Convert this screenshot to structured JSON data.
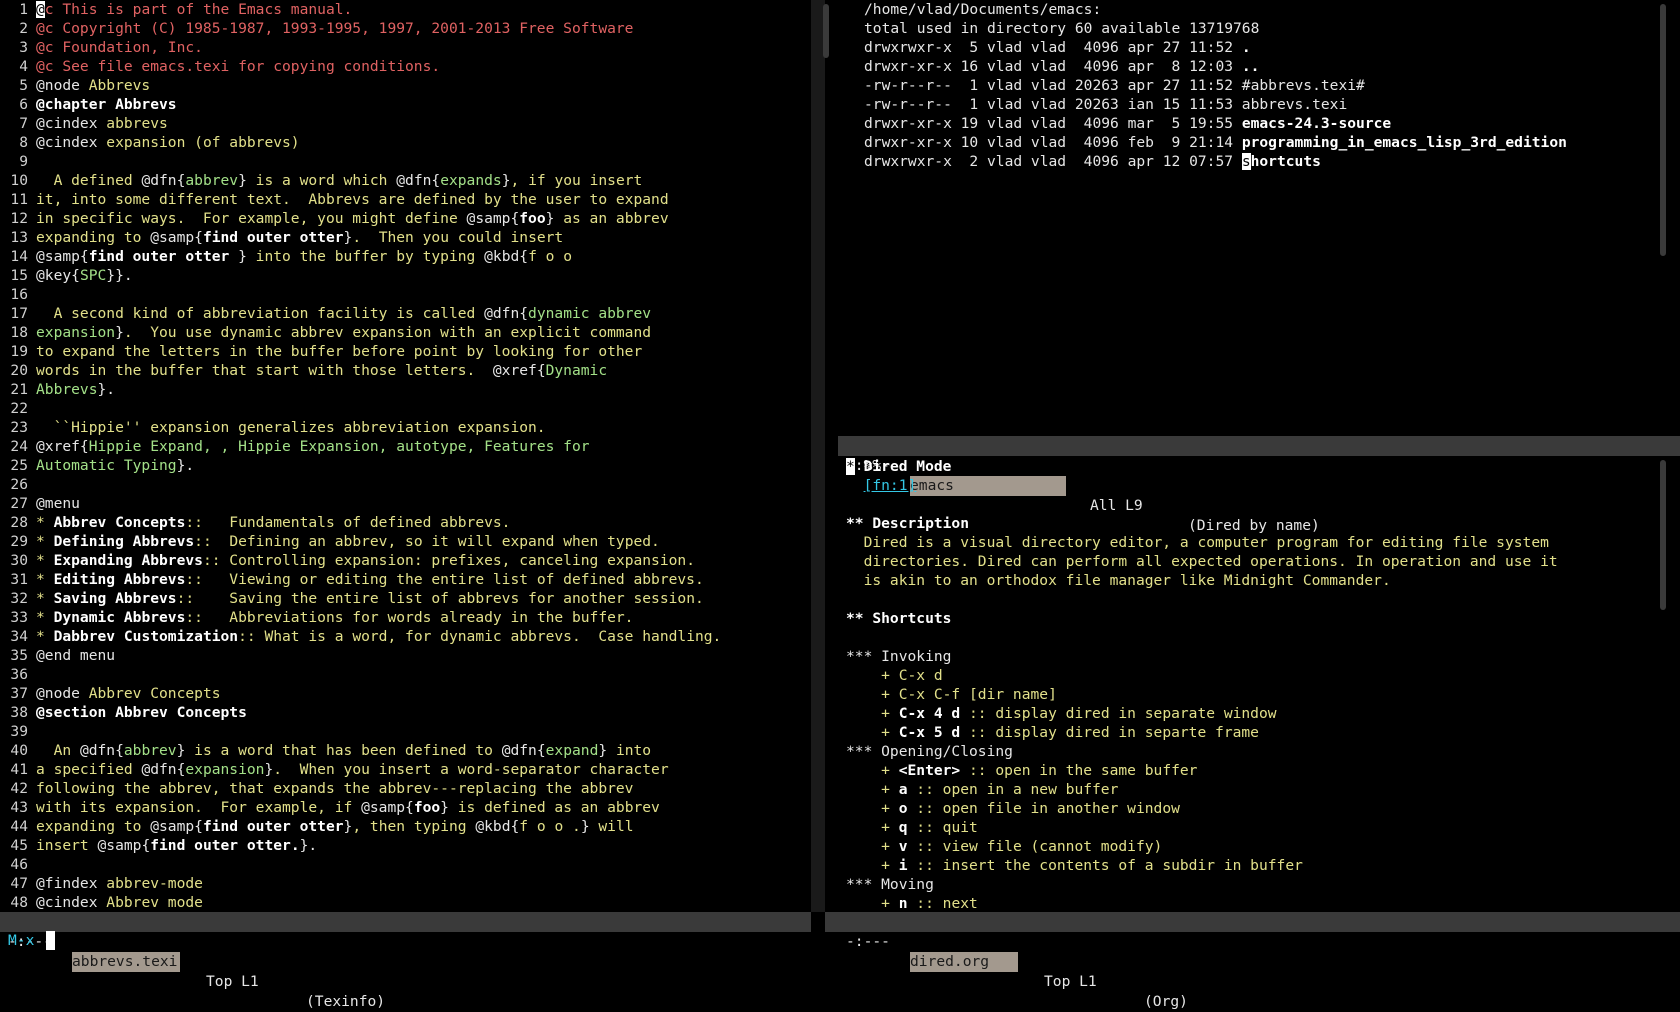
{
  "left_window": {
    "lines": [
      {
        "n": "1",
        "segs": [
          {
            "t": "@",
            "c": "cursor"
          },
          {
            "t": "c This is part of the Emacs manual.",
            "c": "r"
          }
        ]
      },
      {
        "n": "2",
        "segs": [
          {
            "t": "@c Copyright (C) 1985-1987, 1993-1995, 1997, 2001-2013 Free Software",
            "c": "r"
          }
        ]
      },
      {
        "n": "3",
        "segs": [
          {
            "t": "@c Foundation, Inc.",
            "c": "r"
          }
        ]
      },
      {
        "n": "4",
        "segs": [
          {
            "t": "@c See file emacs.texi for copying conditions.",
            "c": "r"
          }
        ]
      },
      {
        "n": "5",
        "segs": [
          {
            "t": "@node ",
            "c": "w"
          },
          {
            "t": "Abbrevs",
            "c": "y"
          }
        ]
      },
      {
        "n": "6",
        "segs": [
          {
            "t": "@chapter Abbrevs",
            "c": "b"
          }
        ]
      },
      {
        "n": "7",
        "segs": [
          {
            "t": "@cindex ",
            "c": "w"
          },
          {
            "t": "abbrevs",
            "c": "y"
          }
        ]
      },
      {
        "n": "8",
        "segs": [
          {
            "t": "@cindex ",
            "c": "w"
          },
          {
            "t": "expansion (of abbrevs)",
            "c": "y"
          }
        ]
      },
      {
        "n": "9",
        "segs": []
      },
      {
        "n": "10",
        "segs": [
          {
            "t": "  A defined ",
            "c": "y"
          },
          {
            "t": "@dfn{",
            "c": "w"
          },
          {
            "t": "abbrev",
            "c": "g"
          },
          {
            "t": "}",
            "c": "w"
          },
          {
            "t": " is a word which ",
            "c": "y"
          },
          {
            "t": "@dfn{",
            "c": "w"
          },
          {
            "t": "expands",
            "c": "g"
          },
          {
            "t": "}",
            "c": "w"
          },
          {
            "t": ", if you insert",
            "c": "y"
          }
        ]
      },
      {
        "n": "11",
        "segs": [
          {
            "t": "it, into some different text.  Abbrevs are defined by the user to expand",
            "c": "y"
          }
        ]
      },
      {
        "n": "12",
        "segs": [
          {
            "t": "in specific ways.  For example, you might define ",
            "c": "y"
          },
          {
            "t": "@samp{",
            "c": "w"
          },
          {
            "t": "foo",
            "c": "b"
          },
          {
            "t": "}",
            "c": "w"
          },
          {
            "t": " as an abbrev",
            "c": "y"
          }
        ]
      },
      {
        "n": "13",
        "segs": [
          {
            "t": "expanding to ",
            "c": "y"
          },
          {
            "t": "@samp{",
            "c": "w"
          },
          {
            "t": "find outer otter",
            "c": "b"
          },
          {
            "t": "}",
            "c": "w"
          },
          {
            "t": ".  Then you could insert",
            "c": "y"
          }
        ]
      },
      {
        "n": "14",
        "segs": [
          {
            "t": "@samp{",
            "c": "w"
          },
          {
            "t": "find outer otter",
            "c": "b"
          },
          {
            "t": " }",
            "c": "w"
          },
          {
            "t": " into the buffer by typing ",
            "c": "y"
          },
          {
            "t": "@kbd{",
            "c": "w"
          },
          {
            "t": "f o o",
            "c": "y"
          }
        ]
      },
      {
        "n": "15",
        "segs": [
          {
            "t": "@key{",
            "c": "w"
          },
          {
            "t": "SPC",
            "c": "g"
          },
          {
            "t": "}}.",
            "c": "w"
          }
        ]
      },
      {
        "n": "16",
        "segs": []
      },
      {
        "n": "17",
        "segs": [
          {
            "t": "  A second kind of abbreviation facility is called ",
            "c": "y"
          },
          {
            "t": "@dfn{",
            "c": "w"
          },
          {
            "t": "dynamic abbrev",
            "c": "g"
          }
        ]
      },
      {
        "n": "18",
        "segs": [
          {
            "t": "expansion",
            "c": "g"
          },
          {
            "t": "}",
            "c": "w"
          },
          {
            "t": ".  You use dynamic abbrev expansion with an explicit command",
            "c": "y"
          }
        ]
      },
      {
        "n": "19",
        "segs": [
          {
            "t": "to expand the letters in the buffer before point by looking for other",
            "c": "y"
          }
        ]
      },
      {
        "n": "20",
        "segs": [
          {
            "t": "words in the buffer that start with those letters.  ",
            "c": "y"
          },
          {
            "t": "@xref{",
            "c": "w"
          },
          {
            "t": "Dynamic",
            "c": "g"
          }
        ]
      },
      {
        "n": "21",
        "segs": [
          {
            "t": "Abbrevs",
            "c": "g"
          },
          {
            "t": "}.",
            "c": "w"
          }
        ]
      },
      {
        "n": "22",
        "segs": []
      },
      {
        "n": "23",
        "segs": [
          {
            "t": "  ``Hippie'' expansion generalizes abbreviation expansion.",
            "c": "y"
          }
        ]
      },
      {
        "n": "24",
        "segs": [
          {
            "t": "@xref{",
            "c": "w"
          },
          {
            "t": "Hippie Expand, , Hippie Expansion, autotype, Features for",
            "c": "g"
          }
        ]
      },
      {
        "n": "25",
        "segs": [
          {
            "t": "Automatic Typing",
            "c": "g"
          },
          {
            "t": "}.",
            "c": "w"
          }
        ]
      },
      {
        "n": "26",
        "segs": []
      },
      {
        "n": "27",
        "segs": [
          {
            "t": "@menu",
            "c": "w"
          }
        ]
      },
      {
        "n": "28",
        "segs": [
          {
            "t": "* ",
            "c": "y"
          },
          {
            "t": "Abbrev Concepts",
            "c": "b"
          },
          {
            "t": "::   Fundamentals of defined abbrevs.",
            "c": "y"
          }
        ]
      },
      {
        "n": "29",
        "segs": [
          {
            "t": "* ",
            "c": "y"
          },
          {
            "t": "Defining Abbrevs",
            "c": "b"
          },
          {
            "t": "::  Defining an abbrev, so it will expand when typed.",
            "c": "y"
          }
        ]
      },
      {
        "n": "30",
        "segs": [
          {
            "t": "* ",
            "c": "y"
          },
          {
            "t": "Expanding Abbrevs",
            "c": "b"
          },
          {
            "t": ":: Controlling expansion: prefixes, canceling expansion.",
            "c": "y"
          }
        ]
      },
      {
        "n": "31",
        "segs": [
          {
            "t": "* ",
            "c": "y"
          },
          {
            "t": "Editing Abbrevs",
            "c": "b"
          },
          {
            "t": "::   Viewing or editing the entire list of defined abbrevs.",
            "c": "y"
          }
        ]
      },
      {
        "n": "32",
        "segs": [
          {
            "t": "* ",
            "c": "y"
          },
          {
            "t": "Saving Abbrevs",
            "c": "b"
          },
          {
            "t": "::    Saving the entire list of abbrevs for another session.",
            "c": "y"
          }
        ]
      },
      {
        "n": "33",
        "segs": [
          {
            "t": "* ",
            "c": "y"
          },
          {
            "t": "Dynamic Abbrevs",
            "c": "b"
          },
          {
            "t": "::   Abbreviations for words already in the buffer.",
            "c": "y"
          }
        ]
      },
      {
        "n": "34",
        "segs": [
          {
            "t": "* ",
            "c": "y"
          },
          {
            "t": "Dabbrev Customization",
            "c": "b"
          },
          {
            "t": ":: What is a word, for dynamic abbrevs.  Case handling.",
            "c": "y"
          }
        ]
      },
      {
        "n": "35",
        "segs": [
          {
            "t": "@end menu",
            "c": "w"
          }
        ]
      },
      {
        "n": "36",
        "segs": []
      },
      {
        "n": "37",
        "segs": [
          {
            "t": "@node ",
            "c": "w"
          },
          {
            "t": "Abbrev Concepts",
            "c": "y"
          }
        ]
      },
      {
        "n": "38",
        "segs": [
          {
            "t": "@section Abbrev Concepts",
            "c": "b"
          }
        ]
      },
      {
        "n": "39",
        "segs": []
      },
      {
        "n": "40",
        "segs": [
          {
            "t": "  An ",
            "c": "y"
          },
          {
            "t": "@dfn{",
            "c": "w"
          },
          {
            "t": "abbrev",
            "c": "g"
          },
          {
            "t": "}",
            "c": "w"
          },
          {
            "t": " is a word that has been defined to ",
            "c": "y"
          },
          {
            "t": "@dfn{",
            "c": "w"
          },
          {
            "t": "expand",
            "c": "g"
          },
          {
            "t": "}",
            "c": "w"
          },
          {
            "t": " into",
            "c": "y"
          }
        ]
      },
      {
        "n": "41",
        "segs": [
          {
            "t": "a specified ",
            "c": "y"
          },
          {
            "t": "@dfn{",
            "c": "w"
          },
          {
            "t": "expansion",
            "c": "g"
          },
          {
            "t": "}",
            "c": "w"
          },
          {
            "t": ".  When you insert a word-separator character",
            "c": "y"
          }
        ]
      },
      {
        "n": "42",
        "segs": [
          {
            "t": "following the abbrev, that expands the abbrev---replacing the abbrev",
            "c": "y"
          }
        ]
      },
      {
        "n": "43",
        "segs": [
          {
            "t": "with its expansion.  For example, if ",
            "c": "y"
          },
          {
            "t": "@samp{",
            "c": "w"
          },
          {
            "t": "foo",
            "c": "b"
          },
          {
            "t": "}",
            "c": "w"
          },
          {
            "t": " is defined as an abbrev",
            "c": "y"
          }
        ]
      },
      {
        "n": "44",
        "segs": [
          {
            "t": "expanding to ",
            "c": "y"
          },
          {
            "t": "@samp{",
            "c": "w"
          },
          {
            "t": "find outer otter",
            "c": "b"
          },
          {
            "t": "}",
            "c": "w"
          },
          {
            "t": ", then typing ",
            "c": "y"
          },
          {
            "t": "@kbd{",
            "c": "w"
          },
          {
            "t": "f o o .",
            "c": "y"
          },
          {
            "t": "}",
            "c": "w"
          },
          {
            "t": " will",
            "c": "y"
          }
        ]
      },
      {
        "n": "45",
        "segs": [
          {
            "t": "insert ",
            "c": "y"
          },
          {
            "t": "@samp{",
            "c": "w"
          },
          {
            "t": "find outer otter.",
            "c": "b"
          },
          {
            "t": "}.",
            "c": "w"
          }
        ]
      },
      {
        "n": "46",
        "segs": []
      },
      {
        "n": "47",
        "segs": [
          {
            "t": "@findex ",
            "c": "w"
          },
          {
            "t": "abbrev-mode",
            "c": "y"
          }
        ]
      },
      {
        "n": "48",
        "segs": [
          {
            "t": "@cindex ",
            "c": "w"
          },
          {
            "t": "Abbrev mode",
            "c": "y"
          }
        ]
      }
    ],
    "modeline": {
      "status": "-:---",
      "buffer": "abbrevs.texi",
      "position": "Top L1",
      "mode": "(Texinfo)"
    }
  },
  "dired_window": {
    "lines": [
      [
        {
          "t": "/home/vlad/Documents/emacs:",
          "c": "w"
        }
      ],
      [
        {
          "t": "total used in directory 60 available 13719768",
          "c": "w"
        }
      ],
      [
        {
          "t": "drwxrwxr-x  5 vlad vlad  4096 apr 27 11:52 ",
          "c": "w"
        },
        {
          "t": ".",
          "c": "b"
        }
      ],
      [
        {
          "t": "drwxr-xr-x 16 vlad vlad  4096 apr  8 12:03 ",
          "c": "w"
        },
        {
          "t": "..",
          "c": "b"
        }
      ],
      [
        {
          "t": "-rw-r--r--  1 vlad vlad 20263 apr 27 11:52 #abbrevs.texi#",
          "c": "w"
        }
      ],
      [
        {
          "t": "-rw-r--r--  1 vlad vlad 20263 ian 15 11:53 abbrevs.texi",
          "c": "w"
        }
      ],
      [
        {
          "t": "drwxr-xr-x 19 vlad vlad  4096 mar  5 19:55 ",
          "c": "w"
        },
        {
          "t": "emacs-24.3-source",
          "c": "b"
        }
      ],
      [
        {
          "t": "drwxr-xr-x 10 vlad vlad  4096 feb  9 21:14 ",
          "c": "w"
        },
        {
          "t": "programming_in_emacs_lisp_3rd_edition",
          "c": "b"
        }
      ],
      [
        {
          "t": "drwxrwxr-x  2 vlad vlad  4096 apr 12 07:57 ",
          "c": "w"
        },
        {
          "t": "s",
          "c": "cursor"
        },
        {
          "t": "hortcuts",
          "c": "b"
        }
      ]
    ],
    "modeline": {
      "status": "U:%%-",
      "buffer": "emacs",
      "position": "All L9",
      "mode": "(Dired by name)"
    }
  },
  "org_window": {
    "lines": [
      [
        {
          "t": "*",
          "c": "cursor"
        },
        {
          "t": " Dired Mode",
          "c": "b"
        }
      ],
      [
        {
          "t": "  ",
          "c": "w"
        },
        {
          "t": "[fn:1]",
          "c": "c"
        }
      ],
      [],
      [
        {
          "t": "** Description",
          "c": "b"
        }
      ],
      [
        {
          "t": "  Dired is a visual directory editor, a computer program for editing file system",
          "c": "y"
        }
      ],
      [
        {
          "t": "  directories. Dired can perform all expected operations. In operation and use it",
          "c": "y"
        }
      ],
      [
        {
          "t": "  is akin to an orthodox file manager like Midnight Commander.",
          "c": "y"
        }
      ],
      [],
      [
        {
          "t": "** Shortcuts",
          "c": "b"
        }
      ],
      [],
      [
        {
          "t": "*** Invoking",
          "c": "w"
        }
      ],
      [
        {
          "t": "    + C-x d",
          "c": "y"
        }
      ],
      [
        {
          "t": "    + C-x C-f [dir name]",
          "c": "y"
        }
      ],
      [
        {
          "t": "    + ",
          "c": "y"
        },
        {
          "t": "C-x 4 d",
          "c": "b"
        },
        {
          "t": " :: display dired in separate window",
          "c": "y"
        }
      ],
      [
        {
          "t": "    + ",
          "c": "y"
        },
        {
          "t": "C-x 5 d",
          "c": "b"
        },
        {
          "t": " :: display dired in separte frame",
          "c": "y"
        }
      ],
      [
        {
          "t": "*** Opening/Closing",
          "c": "w"
        }
      ],
      [
        {
          "t": "    + ",
          "c": "y"
        },
        {
          "t": "<Enter>",
          "c": "b"
        },
        {
          "t": " :: open in the same buffer",
          "c": "y"
        }
      ],
      [
        {
          "t": "    + ",
          "c": "y"
        },
        {
          "t": "a",
          "c": "b"
        },
        {
          "t": " :: open in a new buffer",
          "c": "y"
        }
      ],
      [
        {
          "t": "    + ",
          "c": "y"
        },
        {
          "t": "o",
          "c": "b"
        },
        {
          "t": " :: open file in another window",
          "c": "y"
        }
      ],
      [
        {
          "t": "    + ",
          "c": "y"
        },
        {
          "t": "q",
          "c": "b"
        },
        {
          "t": " :: quit",
          "c": "y"
        }
      ],
      [
        {
          "t": "    + ",
          "c": "y"
        },
        {
          "t": "v",
          "c": "b"
        },
        {
          "t": " :: view file (cannot modify)",
          "c": "y"
        }
      ],
      [
        {
          "t": "    + ",
          "c": "y"
        },
        {
          "t": "i",
          "c": "b"
        },
        {
          "t": " :: insert the contents of a subdir in buffer",
          "c": "y"
        }
      ],
      [
        {
          "t": "*** Moving",
          "c": "w"
        }
      ],
      [
        {
          "t": "    + ",
          "c": "y"
        },
        {
          "t": "n",
          "c": "b"
        },
        {
          "t": " :: next",
          "c": "y"
        }
      ]
    ],
    "modeline": {
      "status": "-:---",
      "buffer": "dired.org",
      "position": "Top L1",
      "mode": "(Org)"
    }
  },
  "minibuffer": {
    "prompt": "M-x "
  },
  "colors": {
    "background": "#000000",
    "comment": "#e06262",
    "text": "#e2e08a",
    "arg": "#a3e088",
    "link": "#34c8e6"
  }
}
